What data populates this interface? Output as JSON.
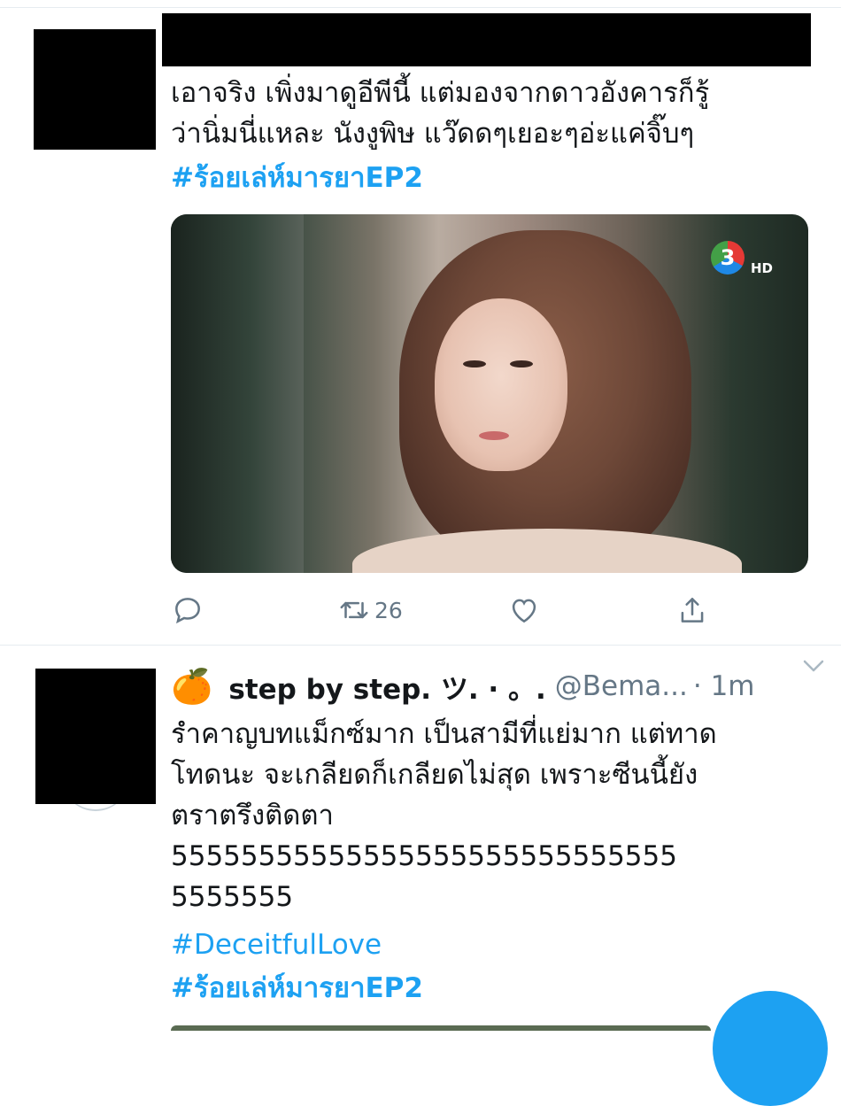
{
  "tweets": [
    {
      "text": "เอาจริง เพิ่งมาดูอีพีนี้ แต่มองจากดาวอังคารก็รู้\nว่านิ่มนี่แหละ นังงูพิษ แว๊ดดๆเยอะๆอ่ะแค่จิ๊บๆ",
      "hashtags": [
        "#ร้อยเล่ห์มารยาEP2"
      ],
      "media": {
        "channel_logo": "3",
        "channel_badge": "HD"
      },
      "actions": {
        "reply_icon": "reply-icon",
        "retweet_count": "26",
        "like_icon": "heart-icon",
        "share_icon": "share-icon"
      }
    },
    {
      "emoji": "🍊",
      "display_name": "step by step. ツ. · 。.",
      "handle": "@Bema...",
      "time": "· 1m",
      "text": "รำคาญบทแม็กซ์มาก เป็นสามีที่แย่มาก แต่ทาด\nโทดนะ จะเกลียดก็เกลียดไม่สุด เพราะซีนนี้ยัง\nตราตรึงติดตา\n55555555555555555555555555555\n5555555",
      "hashtags": [
        "#DeceitfulLove",
        "#ร้อยเล่ห์มารยาEP2"
      ]
    }
  ],
  "colors": {
    "link": "#1da1f2",
    "muted": "#657786",
    "divider": "#e6ecf0"
  }
}
